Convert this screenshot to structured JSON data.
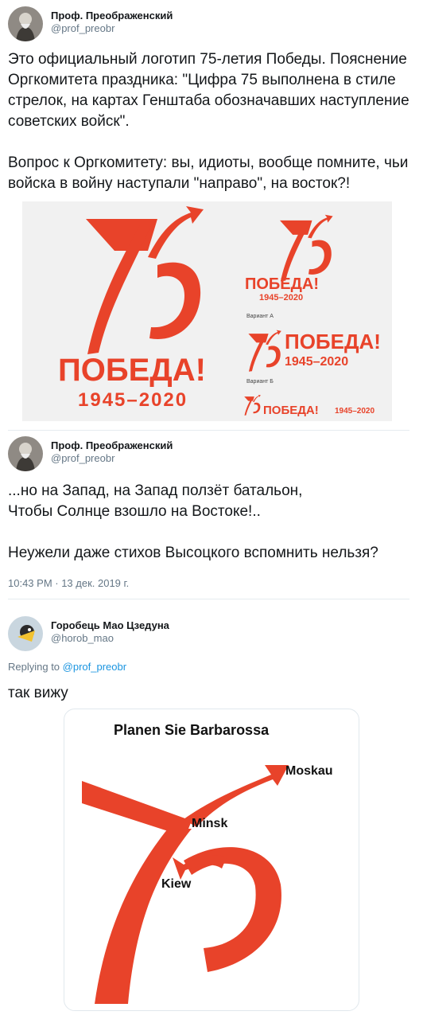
{
  "tweet1": {
    "author_name": "Проф. Преображенский",
    "author_handle": "@prof_preobr",
    "text": "Это официальный логотип 75-летия Победы. Пояснение Оргкомитета праздника: \"Цифра 75 выполнена в стиле стрелок, на картах Генштаба обозначавших наступление советских войск\".\n\nВопрос к Оргкомитету: вы, идиоты, вообще помните, чьи войска в войну наступали \"направо\", на восток?!",
    "logo": {
      "main_word": "ПОБЕДА!",
      "main_years": "1945–2020",
      "variant_a_word": "ПОБЕДА!",
      "variant_a_years": "1945–2020",
      "variant_a_label": "Вариант А",
      "variant_b_word": "ПОБЕДА!",
      "variant_b_years": "1945–2020",
      "variant_b_label": "Вариант Б",
      "variant_c_word": "ПОБЕДА!",
      "variant_c_years": "1945–2020",
      "brand_color": "#e8432a"
    }
  },
  "tweet2": {
    "author_name": "Проф. Преображенский",
    "author_handle": "@prof_preobr",
    "text": "...но на Запад, на Запад ползёт батальон,\nЧтобы Солнце взошло на Востоке!..\n\nНеужели даже стихов Высоцкого вспомнить нельзя?",
    "timestamp": "10:43 PM · 13 дек. 2019 г."
  },
  "reply": {
    "author_name": "Горобець Мао Цзедуна",
    "author_handle": "@horob_mao",
    "replying_prefix": "Replying to",
    "replying_to": "@prof_preobr",
    "text": "так вижу",
    "map": {
      "title": "Planen Sie Barbarossa",
      "label_moskau": "Moskau",
      "label_minsk": "Minsk",
      "label_kiew": "Kiew"
    }
  },
  "colors": {
    "link": "#1b95e0",
    "muted": "#657786",
    "red": "#e8432a"
  }
}
